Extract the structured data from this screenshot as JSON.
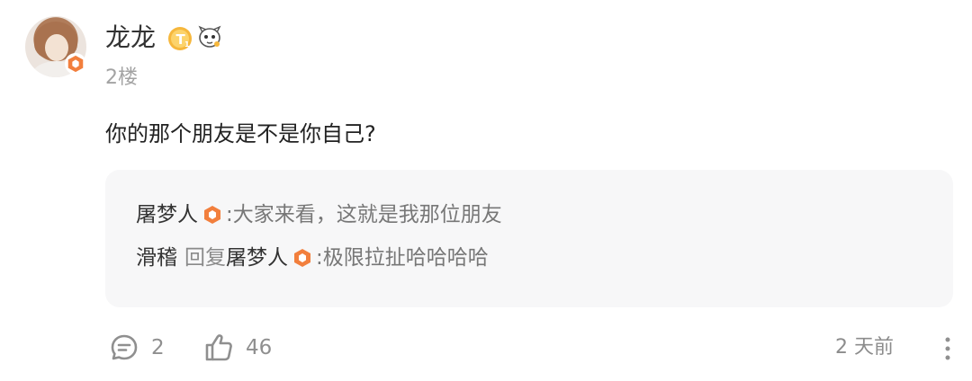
{
  "post": {
    "author": "龙龙",
    "floor": "2楼",
    "comment": "你的那个朋友是不是你自己?",
    "time": "2 天前"
  },
  "replies": [
    {
      "name": "屠梦人",
      "separator": ":",
      "text": "大家来看，这就是我那位朋友"
    },
    {
      "name": "滑稽",
      "reply_verb": "回复",
      "target": "屠梦人",
      "separator": ":",
      "text": "极限拉扯哈哈哈哈"
    }
  ],
  "actions": {
    "comment_count": "2",
    "like_count": "46"
  },
  "badges": {
    "level_letter": "T",
    "level_number": "1"
  },
  "icons": {
    "avatar": "user-avatar",
    "avatar_badge": "verified-hex-icon",
    "level_badge": "level-t1-icon",
    "mascot_badge": "mascot-icon",
    "reply_badge": "orange-hex-icon",
    "comment": "comment-bubble-icon",
    "like": "thumbs-up-icon",
    "more": "more-vertical-icon"
  },
  "colors": {
    "accent_orange": "#f27f3d",
    "level_gold": "#f6b73c",
    "reply_background": "#f7f7f8",
    "muted_text": "#8f8f8f"
  }
}
